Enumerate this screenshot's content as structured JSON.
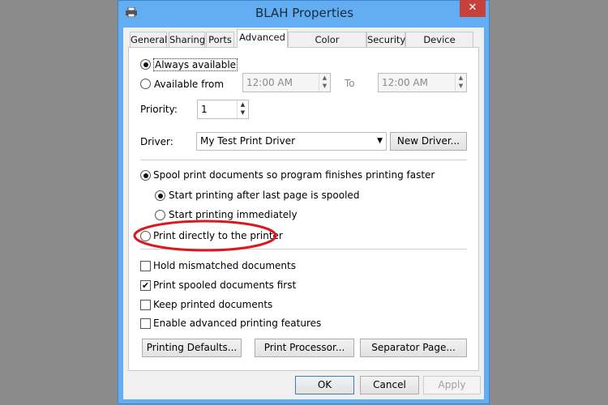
{
  "window": {
    "title": "BLAH Properties",
    "close": "✕",
    "icon": "printer-icon"
  },
  "tabs": [
    "General",
    "Sharing",
    "Ports",
    "Advanced",
    "Color Management",
    "Security",
    "Device Settings"
  ],
  "selected_tab": "Advanced",
  "availability": {
    "always": "Always available",
    "from": "Available from",
    "from_time": "12:00 AM",
    "to_label": "To",
    "to_time": "12:00 AM",
    "selected": "always"
  },
  "priority": {
    "label": "Priority:",
    "value": "1"
  },
  "driver": {
    "label": "Driver:",
    "value": "My Test Print Driver",
    "new_button": "New Driver..."
  },
  "spool": {
    "spool_option": "Spool print documents so program finishes printing faster",
    "after_last": "Start printing after last page is spooled",
    "immediately": "Start printing immediately",
    "direct": "Print directly to the printer"
  },
  "annotation": {
    "color": "#d9191e",
    "target": "Print directly to the printer"
  },
  "checkboxes": [
    {
      "label": "Hold mismatched documents",
      "checked": false
    },
    {
      "label": "Print spooled documents first",
      "checked": true
    },
    {
      "label": "Keep printed documents",
      "checked": false
    },
    {
      "label": "Enable advanced printing features",
      "checked": false
    }
  ],
  "buttons": {
    "defaults": "Printing Defaults...",
    "processor": "Print Processor...",
    "separator": "Separator Page...",
    "ok": "OK",
    "cancel": "Cancel",
    "apply": "Apply"
  },
  "check_glyph": "✔"
}
